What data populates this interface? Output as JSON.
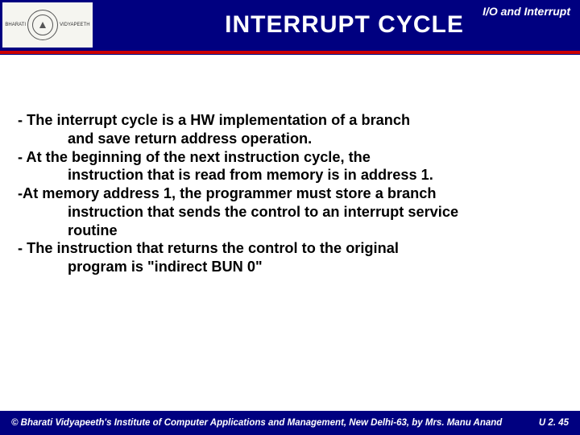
{
  "header": {
    "title": "INTERRUPT  CYCLE",
    "topic": "I/O and Interrupt",
    "logo_left": "BHARATI",
    "logo_right": "VIDYAPEETH"
  },
  "body": {
    "l1": "- The interrupt cycle is a HW implementation of a branch",
    "l2": "and save return address operation.",
    "l3": "- At the beginning of the next instruction cycle, the",
    "l4": "instruction that is read from memory is in address 1.",
    "l5": "-At memory address 1, the programmer must store a branch",
    "l6": "instruction that sends the control to an interrupt service",
    "l7": "routine",
    "l8": "- The instruction that returns the control to the original",
    "l9": "program is  \"indirect BUN   0\""
  },
  "footer": {
    "copyright": "© Bharati Vidyapeeth's Institute of Computer Applications and Management, New Delhi-63, by Mrs. Manu Anand",
    "page": "U 2. 45"
  }
}
